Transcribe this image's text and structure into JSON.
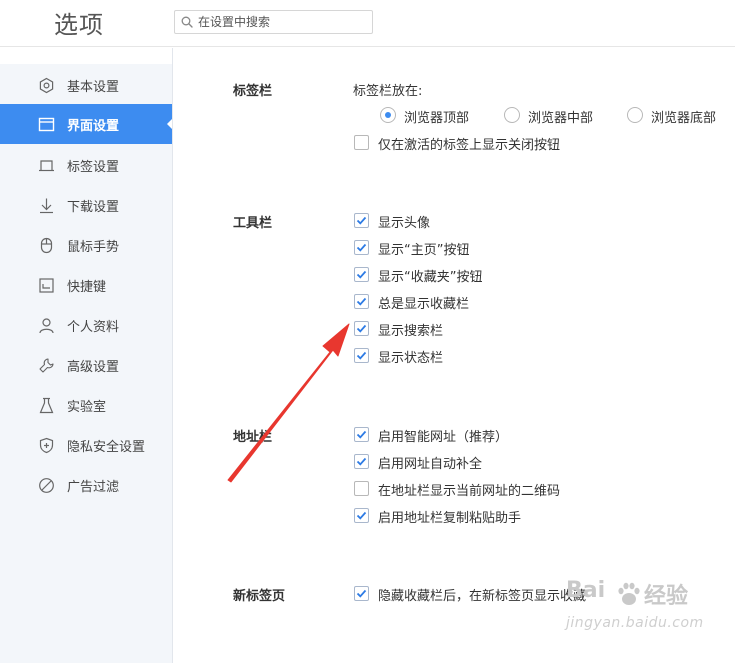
{
  "header": {
    "title": "选项",
    "search_placeholder": "在设置中搜索"
  },
  "sidebar": {
    "items": [
      {
        "label": "基本设置",
        "icon": "gear-icon",
        "active": false
      },
      {
        "label": "界面设置",
        "icon": "window-icon",
        "active": true
      },
      {
        "label": "标签设置",
        "icon": "tab-icon",
        "active": false
      },
      {
        "label": "下载设置",
        "icon": "download-icon",
        "active": false
      },
      {
        "label": "鼠标手势",
        "icon": "mouse-icon",
        "active": false
      },
      {
        "label": "快捷键",
        "icon": "keyboard-shortcut-icon",
        "active": false
      },
      {
        "label": "个人资料",
        "icon": "person-icon",
        "active": false
      },
      {
        "label": "高级设置",
        "icon": "wrench-icon",
        "active": false
      },
      {
        "label": "实验室",
        "icon": "flask-icon",
        "active": false
      },
      {
        "label": "隐私安全设置",
        "icon": "shield-icon",
        "active": false
      },
      {
        "label": "广告过滤",
        "icon": "block-icon",
        "active": false
      }
    ]
  },
  "main": {
    "tabbar": {
      "title": "标签栏",
      "position_label": "标签栏放在:",
      "positions": [
        {
          "label": "浏览器顶部",
          "selected": true
        },
        {
          "label": "浏览器中部",
          "selected": false
        },
        {
          "label": "浏览器底部",
          "selected": false
        }
      ],
      "options": [
        {
          "label": "仅在激活的标签上显示关闭按钮",
          "checked": false
        }
      ]
    },
    "toolbar": {
      "title": "工具栏",
      "options": [
        {
          "label": "显示头像",
          "checked": true
        },
        {
          "label": "显示“主页”按钮",
          "checked": true
        },
        {
          "label": "显示“收藏夹”按钮",
          "checked": true
        },
        {
          "label": "总是显示收藏栏",
          "checked": true
        },
        {
          "label": "显示搜索栏",
          "checked": true
        },
        {
          "label": "显示状态栏",
          "checked": true
        }
      ]
    },
    "addressbar": {
      "title": "地址栏",
      "options": [
        {
          "label": "启用智能网址（推荐）",
          "checked": true
        },
        {
          "label": "启用网址自动补全",
          "checked": true
        },
        {
          "label": "在地址栏显示当前网址的二维码",
          "checked": false
        },
        {
          "label": "启用地址栏复制粘贴助手",
          "checked": true
        }
      ]
    },
    "newtab": {
      "title": "新标签页",
      "options": [
        {
          "label": "隐藏收藏栏后，在新标签页显示收藏",
          "checked": true
        }
      ]
    }
  },
  "watermark": {
    "brand_left": "Bai",
    "brand_right": "经验",
    "url": "jingyan.baidu.com"
  },
  "colors": {
    "accent": "#3d8cf0",
    "sidebar_bg": "#f3f6fa",
    "annotation_arrow": "#e8372f"
  }
}
